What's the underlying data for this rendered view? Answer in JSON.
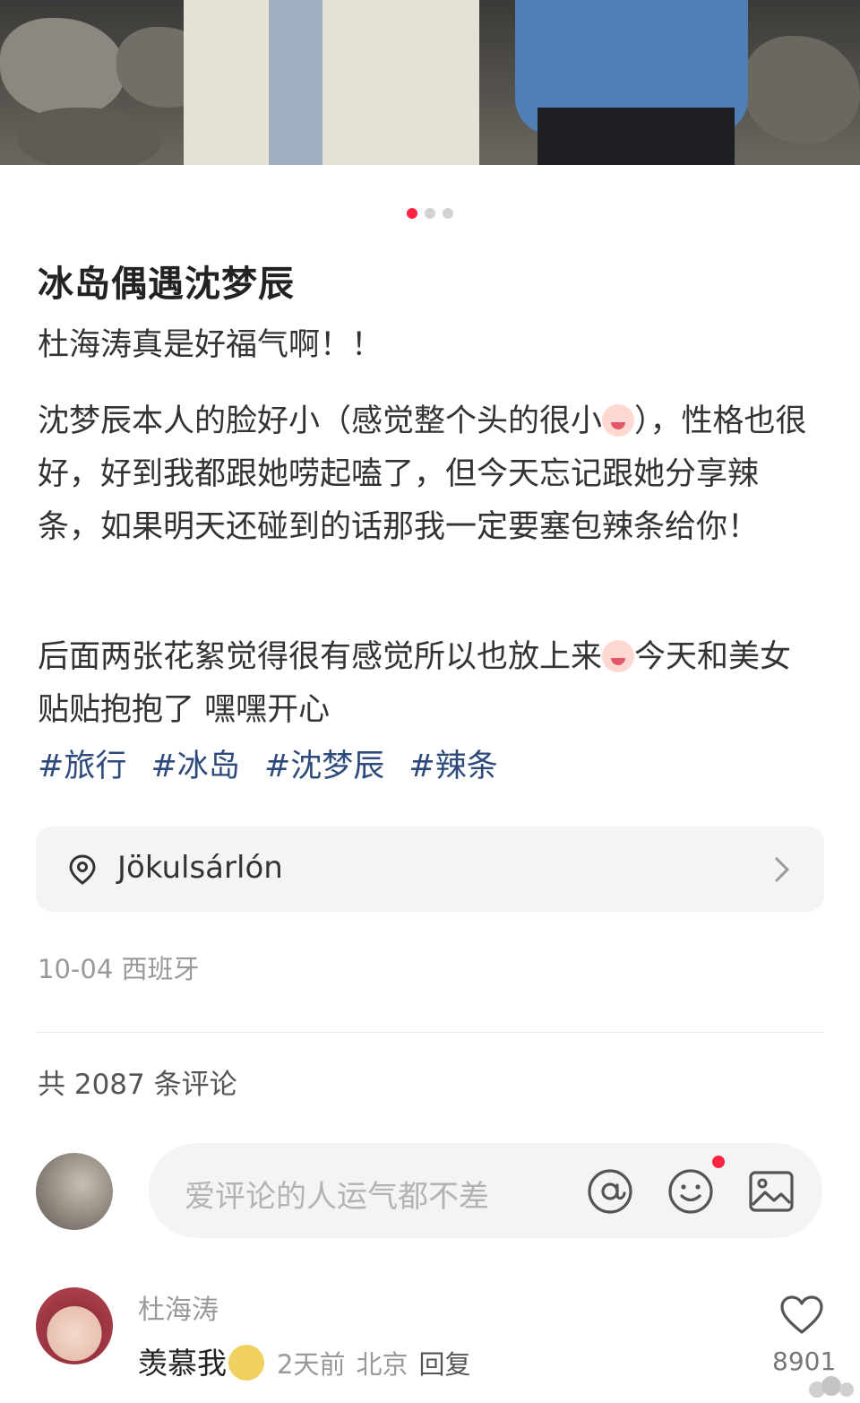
{
  "post": {
    "title": "冰岛偶遇沈梦辰",
    "paragraph1": "杜海涛真是好福气啊！！",
    "paragraph2_a": "沈梦辰本人的脸好小（感觉整个头的很小",
    "paragraph2_b": "），性格也很好，好到我都跟她唠起嗑了，但今天忘记跟她分享辣条，如果明天还碰到的话那我一定要塞包辣条给你！",
    "paragraph3_a": "后面两张花絮觉得很有感觉所以也放上来",
    "paragraph3_b": "今天和美女贴贴抱抱了 嘿嘿开心",
    "tags": [
      "#旅行",
      "#冰岛",
      "#沈梦辰",
      "#辣条"
    ],
    "location": "Jökulsárlón",
    "date_region": "10-04 西班牙"
  },
  "carousel": {
    "page_count": 3,
    "active_index": 0,
    "active_color": "#ff2442"
  },
  "comments": {
    "count_label": "共 2087 条评论",
    "input_placeholder": "爱评论的人运气都不差",
    "items": [
      {
        "author": "杜海涛",
        "text": "羡慕我",
        "time": "2天前",
        "region": "北京",
        "reply_label": "回复",
        "likes": "8901"
      }
    ]
  },
  "icons": {
    "location": "location-pin-icon",
    "chevron": "chevron-right-icon",
    "at": "at-icon",
    "emoji": "emoji-icon",
    "image": "image-icon",
    "like": "heart-icon"
  }
}
